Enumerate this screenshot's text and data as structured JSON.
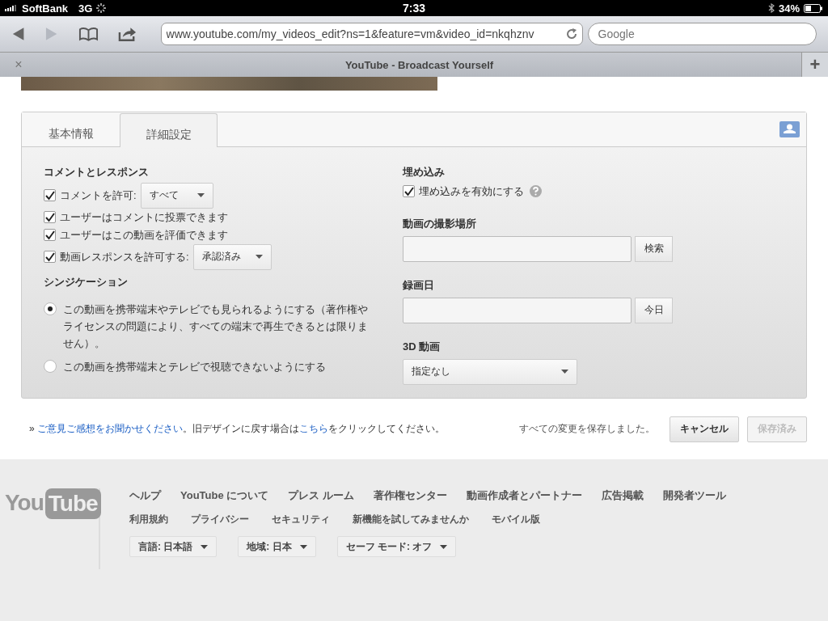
{
  "status_bar": {
    "carrier": "SoftBank",
    "network": "3G",
    "time": "7:33",
    "battery": "34%"
  },
  "browser": {
    "url": "www.youtube.com/my_videos_edit?ns=1&feature=vm&video_id=nkqhznv",
    "search": {
      "placeholder": "Google"
    },
    "tab_title": "YouTube - Broadcast Yourself",
    "close": "×",
    "new_tab": "+"
  },
  "tabs": [
    {
      "label": "基本情報",
      "selected": false
    },
    {
      "label": "詳細設定",
      "selected": true
    }
  ],
  "comments": {
    "title": "コメントとレスポンス",
    "options": [
      {
        "label": "コメントを許可:",
        "checked": true,
        "select": "すべて"
      },
      {
        "label": "ユーザーはコメントに投票できます",
        "checked": true
      },
      {
        "label": "ユーザーはこの動画を評価できます",
        "checked": true
      },
      {
        "label": "動画レスポンスを許可する:",
        "checked": true,
        "select": "承認済み"
      }
    ]
  },
  "syndication": {
    "title": "シンジケーション",
    "options": [
      {
        "label": "この動画を携帯端末やテレビでも見られるようにする（著作権やライセンスの問題により、すべての端末で再生できるとは限りません）。",
        "selected": true
      },
      {
        "label": "この動画を携帯端末とテレビで視聴できないようにする",
        "selected": false
      }
    ]
  },
  "embed": {
    "title": "埋め込み",
    "label": "埋め込みを有効にする",
    "checked": true
  },
  "location": {
    "title": "動画の撮影場所",
    "button": "検索"
  },
  "recorded": {
    "title": "録画日",
    "button": "今日"
  },
  "video_3d": {
    "title": "3D 動画",
    "select": "指定なし"
  },
  "feedback": {
    "prefix": "» ",
    "link": "ご意見ご感想をお聞かせください",
    "middle": "。旧デザインに戻す場合は",
    "link2": "こちら",
    "suffix": "をクリックしてください。"
  },
  "save_status": "すべての変更を保存しました。",
  "buttons": [
    {
      "label": "キャンセル",
      "disabled": false
    },
    {
      "label": "保存済み",
      "disabled": true
    }
  ],
  "footer": {
    "logo": {
      "left": "You",
      "right": "Tube"
    },
    "links": [
      "ヘルプ",
      "YouTube について",
      "プレス ルーム",
      "著作権センター",
      "動画作成者とパートナー",
      "広告掲載",
      "開発者ツール"
    ],
    "links2": [
      "利用規約",
      "プライバシー",
      "セキュリティ",
      "新機能を試してみませんか",
      "モバイル版"
    ],
    "dropdowns": [
      "言語: 日本語",
      "地域: 日本",
      "セーフ モード: オフ"
    ]
  }
}
